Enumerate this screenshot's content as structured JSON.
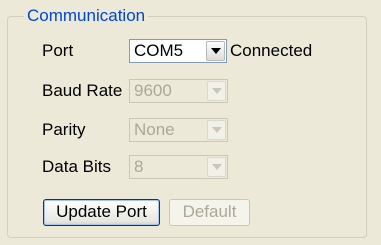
{
  "group": {
    "title": "Communication"
  },
  "fields": {
    "port": {
      "label": "Port",
      "value": "COM5",
      "status": "Connected"
    },
    "baud_rate": {
      "label": "Baud Rate",
      "value": "9600"
    },
    "parity": {
      "label": "Parity",
      "value": "None"
    },
    "data_bits": {
      "label": "Data Bits",
      "value": "8"
    }
  },
  "buttons": {
    "update_port": "Update Port",
    "default": "Default"
  },
  "icons": {
    "combo_arrow": "chevron-down-icon"
  },
  "colors": {
    "title": "#0046d5",
    "disabled_text": "#aca899"
  }
}
